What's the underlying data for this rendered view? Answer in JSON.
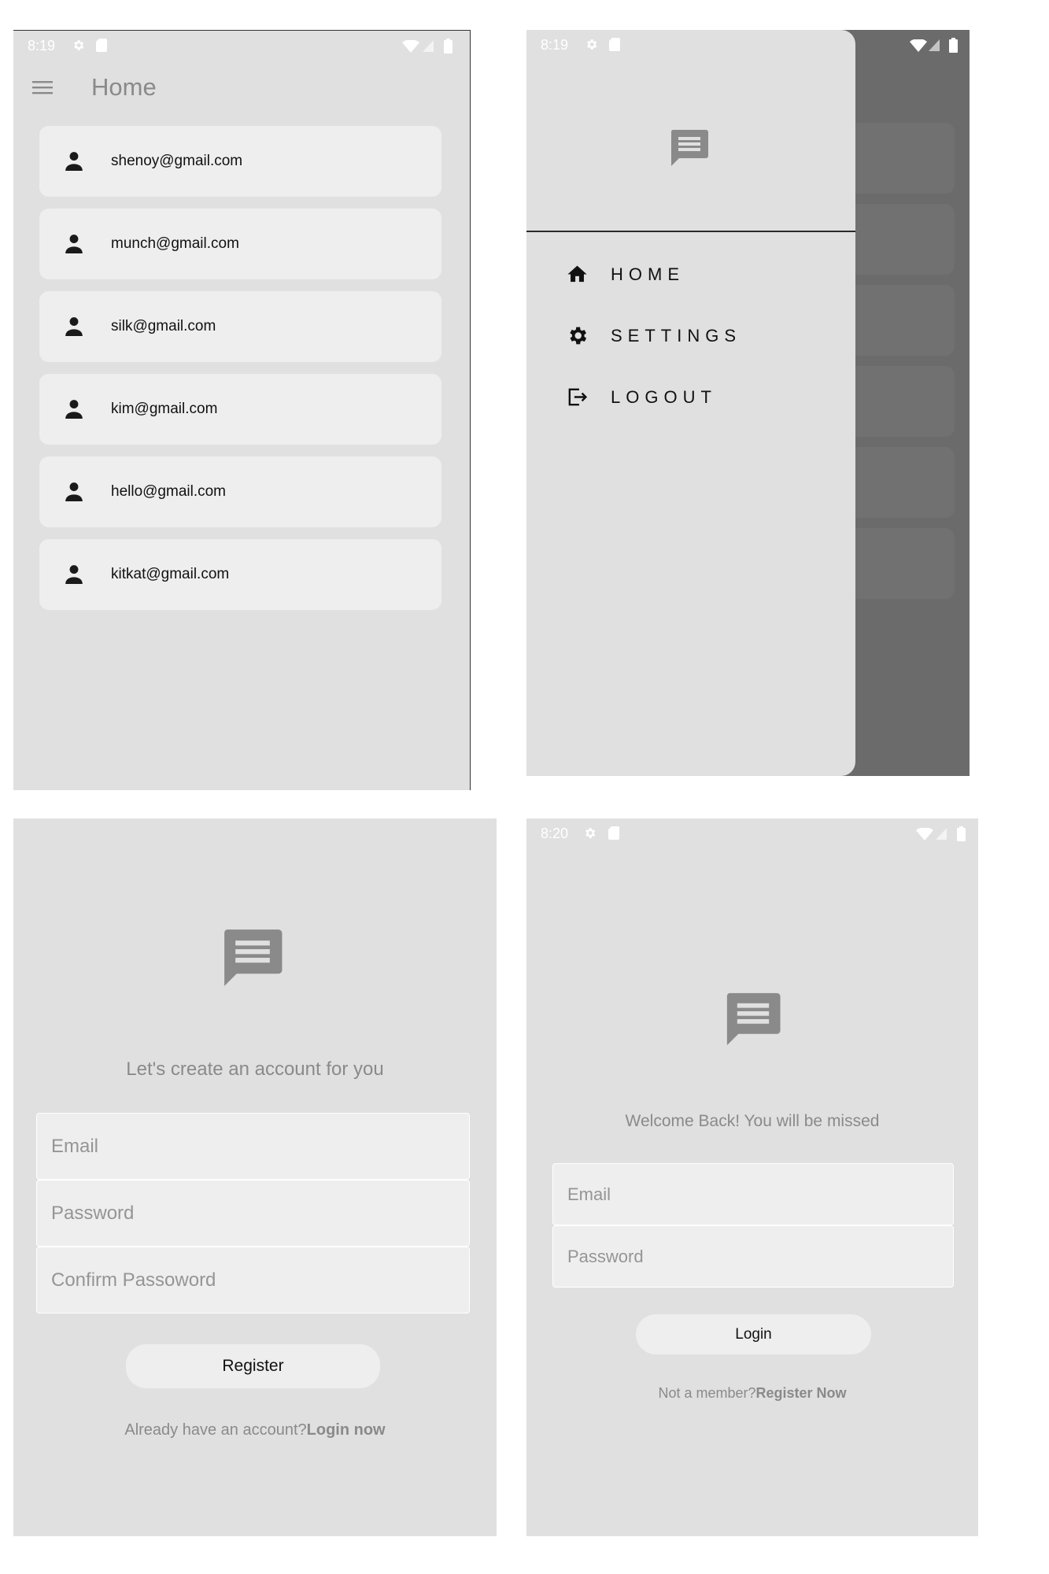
{
  "home": {
    "status_time": "8:19",
    "title": "Home",
    "users": [
      "shenoy@gmail.com",
      "munch@gmail.com",
      "silk@gmail.com",
      "kim@gmail.com",
      "hello@gmail.com",
      "kitkat@gmail.com"
    ]
  },
  "drawer": {
    "status_time": "8:19",
    "items": [
      {
        "label": "HOME",
        "icon": "home-icon"
      },
      {
        "label": "SETTINGS",
        "icon": "gear-icon"
      },
      {
        "label": "LOGOUT",
        "icon": "logout-icon"
      }
    ]
  },
  "register": {
    "subtitle": "Let's create an account for you",
    "email_placeholder": "Email",
    "password_placeholder": "Password",
    "confirm_placeholder": "Confirm Passoword",
    "button_label": "Register",
    "footer_prefix": "Already have an account?",
    "footer_link": "Login now"
  },
  "login": {
    "status_time": "8:20",
    "subtitle": "Welcome Back! You will be missed",
    "email_placeholder": "Email",
    "password_placeholder": "Password",
    "button_label": "Login",
    "footer_prefix": "Not a member?",
    "footer_link": "Register Now"
  },
  "colors": {
    "background": "#e0e0e0",
    "card": "#eeeeee",
    "scrim": "#6b6b6b",
    "muted_text": "#8a8a8a"
  }
}
